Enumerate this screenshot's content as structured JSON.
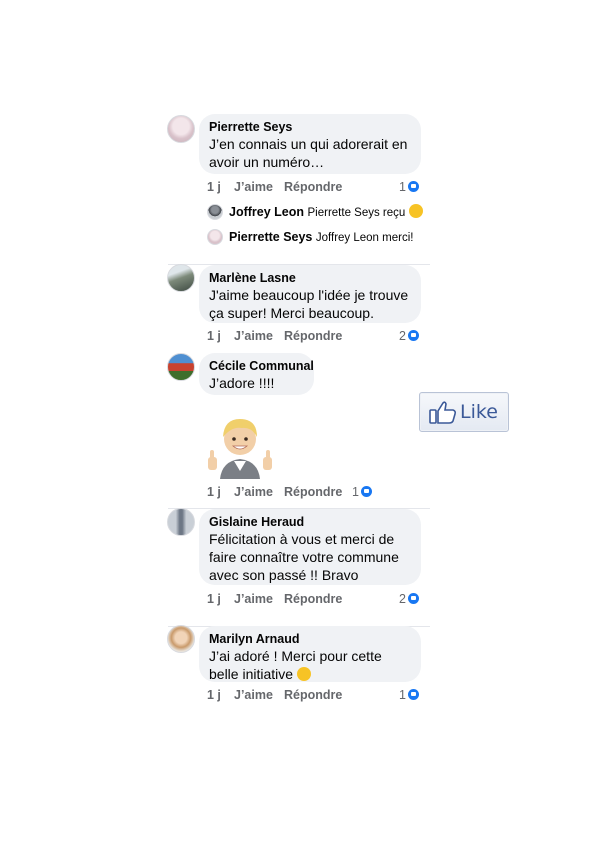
{
  "comments": [
    {
      "author": "Pierrette Seys",
      "lines": [
        "J’en connais un qui adorerait en",
        "avoir un numéro…"
      ],
      "time": "1 j",
      "like": "J’aime",
      "reply": "Répondre",
      "count": "1",
      "replies": [
        {
          "author": "Joffrey Leon",
          "text": "Pierrette Seys reçu"
        },
        {
          "author": "Pierrette Seys",
          "text": "Joffrey Leon merci!"
        }
      ]
    },
    {
      "author": "Marlène Lasne",
      "lines": [
        "J'aime beaucoup l'idée je trouve",
        "ça super! Merci beaucoup."
      ],
      "time": "1 j",
      "like": "J’aime",
      "reply": "Répondre",
      "count": "2"
    },
    {
      "author": "Cécile Communal",
      "lines": [
        "J’adore !!!!"
      ],
      "time": "1 j",
      "like": "J’aime",
      "reply": "Répondre",
      "count": "1"
    },
    {
      "author": "Gislaine Heraud",
      "lines": [
        "Félicitation à vous et merci de",
        "faire connaître votre commune",
        "avec son passé !! Bravo"
      ],
      "time": "1 j",
      "like": "J’aime",
      "reply": "Répondre",
      "count": "2"
    },
    {
      "author": "Marilyn Arnaud",
      "lines": [
        "J’ai adoré ! Merci pour cette",
        "belle initiative"
      ],
      "time": "1 j",
      "like": "J’aime",
      "reply": "Répondre",
      "count": "1"
    }
  ],
  "like_badge": {
    "label": "Like"
  },
  "colors": {
    "bubble": "#f0f2f5",
    "meta": "#65676b",
    "facebook_blue": "#1877f2",
    "like_badge_text": "#3b5998"
  }
}
